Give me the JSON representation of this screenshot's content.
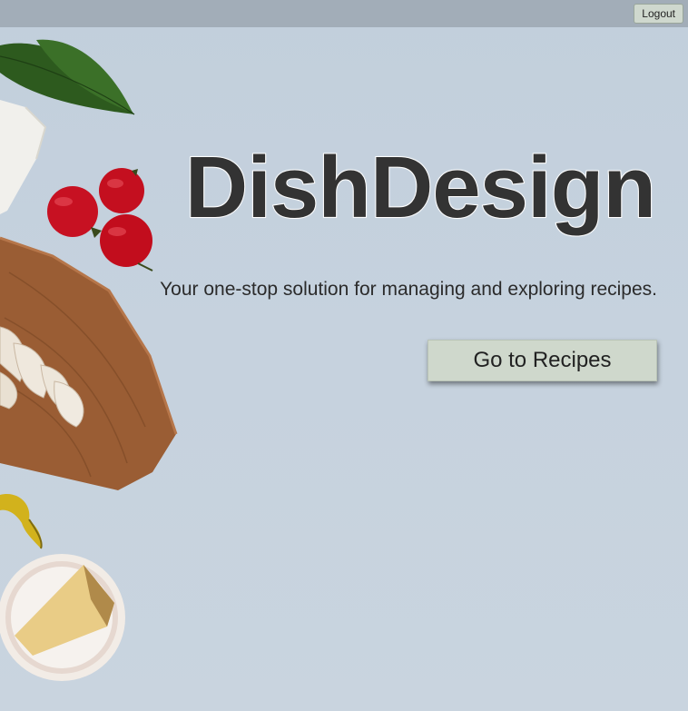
{
  "header": {
    "logout_label": "Logout"
  },
  "hero": {
    "title": "DishDesign",
    "subtitle": "Your one-stop solution for managing and exploring recipes.",
    "cta_label": "Go to Recipes"
  },
  "colors": {
    "background": "#c3d0dc",
    "topbar": "#a2adb8",
    "button": "#cfd8cc",
    "title_text": "#333333"
  },
  "decor": {
    "icons": [
      "basil-leaf",
      "cheese-wedge",
      "tomatoes",
      "cutting-board",
      "mushroom-slices",
      "yellow-pepper",
      "parmesan-bowl"
    ]
  }
}
